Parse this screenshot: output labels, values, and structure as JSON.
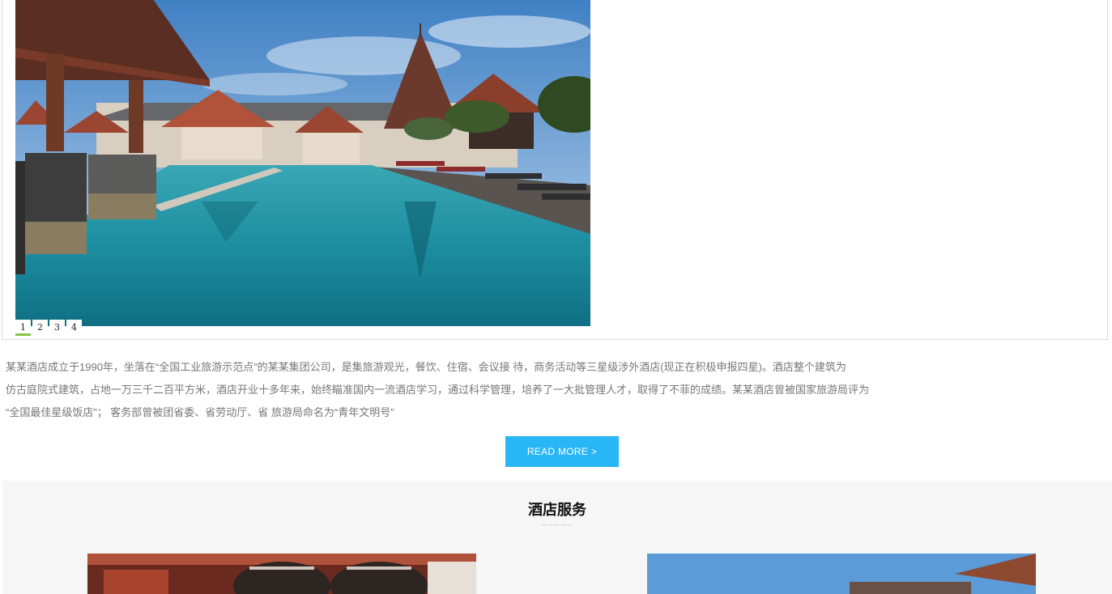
{
  "slider": {
    "image_alt": "酒店泳池",
    "pages": [
      "1",
      "2",
      "3",
      "4"
    ],
    "active_page": 0
  },
  "intro": {
    "lines": [
      "某某酒店成立于1990年，坐落在“全国工业旅游示范点”的某某集团公司，是集旅游观光，餐饮、住宿、会议接 待，商务活动等三星级涉外酒店(现正在积极申报四星)。酒店整个建筑为",
      "仿古庭院式建筑，占地一万三千二百平方米，酒店开业十多年来，始终瞄准国内一流酒店学习，通过科学管理，培养了一大批管理人才，取得了不菲的成绩。某某酒店曾被国家旅游局评为",
      "“全国最佳星级饭店”； 客务部曾被团省委、省劳动厅、省 旅游局命名为“青年文明号”"
    ]
  },
  "read_more_label": "READ MORE >",
  "services": {
    "title": "酒店服务",
    "divider": "~~~~~"
  },
  "colors": {
    "accent": "#29b6f6",
    "section_bg": "#f6f6f6",
    "body_text": "#777777"
  }
}
